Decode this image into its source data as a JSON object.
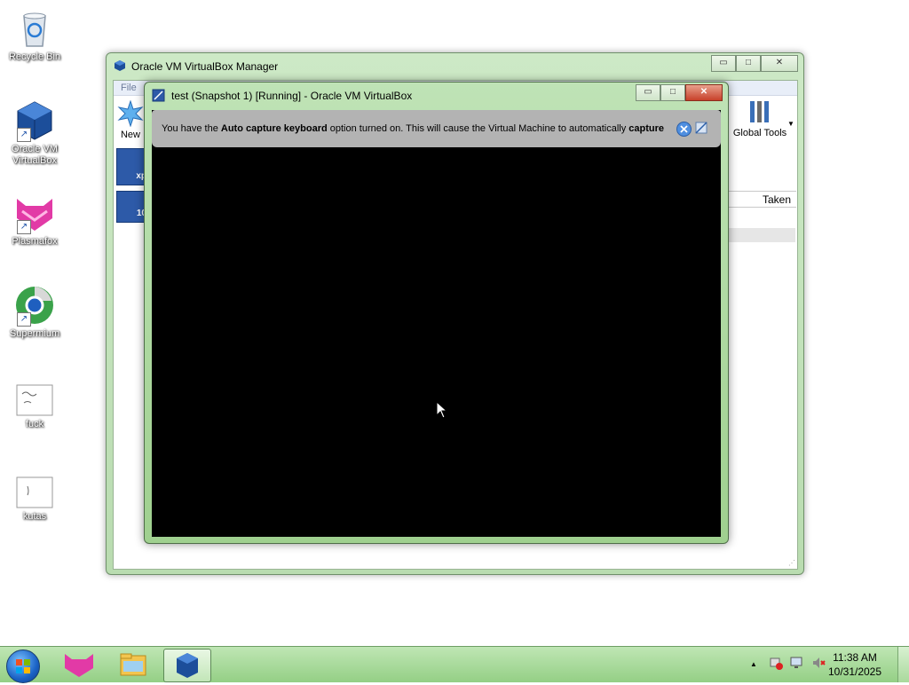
{
  "desktop": {
    "icons": [
      {
        "label": "Recycle Bin",
        "icon": "recycle-bin-icon"
      },
      {
        "label": "Oracle VM VirtualBox",
        "icon": "virtualbox-icon"
      },
      {
        "label": "Plasmafox",
        "icon": "plasmafox-icon"
      },
      {
        "label": "Supermium",
        "icon": "supermium-icon"
      },
      {
        "label": "fuck",
        "icon": "image-file-icon"
      },
      {
        "label": "kutas",
        "icon": "image-file-icon"
      }
    ]
  },
  "manager_window": {
    "title": "Oracle VM VirtualBox Manager",
    "menu_file": "File",
    "new_label": "New",
    "vm_badges": [
      "xp",
      "10"
    ],
    "global_tools_label": "Global Tools",
    "snapshot_column_taken": "Taken",
    "buttons": {
      "minimize": "▭",
      "maximize": "□",
      "close": "✕"
    }
  },
  "vm_window": {
    "title": "test (Snapshot 1) [Running] - Oracle VM VirtualBox",
    "notice": {
      "prefix": "You have the ",
      "bold1": "Auto capture keyboard",
      "middle": " option turned on. This will cause the Virtual Machine to automatically ",
      "bold2": "capture"
    },
    "buttons": {
      "minimize": "▭",
      "maximize": "□",
      "close": "✕"
    }
  },
  "taskbar": {
    "items": [
      "plasmafox",
      "file-explorer",
      "virtualbox"
    ],
    "tray_arrow": "▲",
    "clock_time": "11:38 AM",
    "clock_date": "10/31/2025"
  },
  "colors": {
    "window_frame": "#b9dcb0",
    "taskbar": "#94cf85",
    "notice_bar": "#b3b3b3",
    "vm_screen": "#000000"
  }
}
